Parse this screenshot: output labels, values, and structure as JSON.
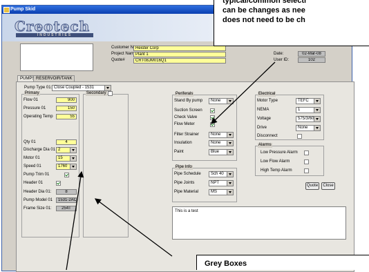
{
  "window": {
    "title": "Pump Skid"
  },
  "logo": {
    "text": "Creotech",
    "sub": "INDUSTRIES"
  },
  "header": {
    "customer_label": "Customer Name",
    "customer_value": "Heister Corp",
    "project_label": "Project Name",
    "project_value": "Plant 1",
    "quote_label": "Quote#",
    "quote_value": "CRT08JM016Q1",
    "date_label": "Date:",
    "date_value": "02-Mar-08",
    "userid_label": "User ID:",
    "userid_value": "102"
  },
  "tabs": [
    "PUMPS",
    "RESERVOIR/TANK"
  ],
  "pump_type": {
    "label": "Pump Type 01:",
    "value": "Close Coupled - 1531"
  },
  "primary": {
    "title": "Primary",
    "flow_label": "Flow 01",
    "flow_value": "900",
    "pressure_label": "Pressure 01",
    "pressure_value": "150",
    "optemp_label": "Operating Temp",
    "optemp_value": "55",
    "qty_label": "Qty 01",
    "qty_value": "4",
    "discharge_label": "Discharge Dia 01",
    "discharge_value": "2",
    "motor_label": "Motor 01",
    "motor_value": "15",
    "speed_label": "Speed 01",
    "speed_value": "1760",
    "trim_label": "Pump Trim 01",
    "header_label": "Header 01",
    "header_dia_label": "Header Dia 01:",
    "header_dia_value": "8",
    "model_label": "Pump Model 01",
    "model_value": "1531-2AC",
    "frame_label": "Frame Size 01:",
    "frame_value": "254T"
  },
  "secondary": {
    "title": "Secondary"
  },
  "peripherals": {
    "title": "Periferals",
    "standby_label": "Stand By pump",
    "standby_value": "None",
    "suction_label": "Suction Screen",
    "check_label": "Check Valve",
    "flow_meter_label": "Flow Meter",
    "filter_label": "Filter Strainer",
    "filter_value": "None",
    "insulation_label": "Insulation",
    "insulation_value": "None",
    "paint_label": "Paint",
    "paint_value": "Blue"
  },
  "pipe_info": {
    "title": "Pipe Info",
    "schedule_label": "Pipe Schedule",
    "schedule_value": "Sch 40",
    "joints_label": "Pipe Joints",
    "joints_value": "NPT",
    "material_label": "Pipe Material",
    "material_value": "MS"
  },
  "electrical": {
    "title": "Electrical",
    "motor_type_label": "Motor Type",
    "motor_type_value": "TEFC",
    "nema_label": "NEMA",
    "nema_value": "1",
    "voltage_label": "Voltage",
    "voltage_value": "575/3/60",
    "drive_label": "Drive",
    "drive_value": "None",
    "disconnect_label": "Disconnect"
  },
  "alarms": {
    "title": "Alarms",
    "low_pressure_label": "Low Pressure Alarm",
    "low_flow_label": "Low Flow Alarm",
    "high_temp_label": "High Temp Alarm"
  },
  "buttons": {
    "quote": "Quote",
    "close": "Close"
  },
  "notes": {
    "value": "This is a test"
  },
  "callouts": {
    "top_line1": "typical/common selecti",
    "top_line2": "can be changes as nee",
    "top_line3": "does not need to be ch",
    "bottom": "Grey Boxes"
  },
  "colors": {
    "required_field": "#ffff99",
    "calculated_field": "#bfbfbf",
    "titlebar": "#0a3fb0"
  }
}
